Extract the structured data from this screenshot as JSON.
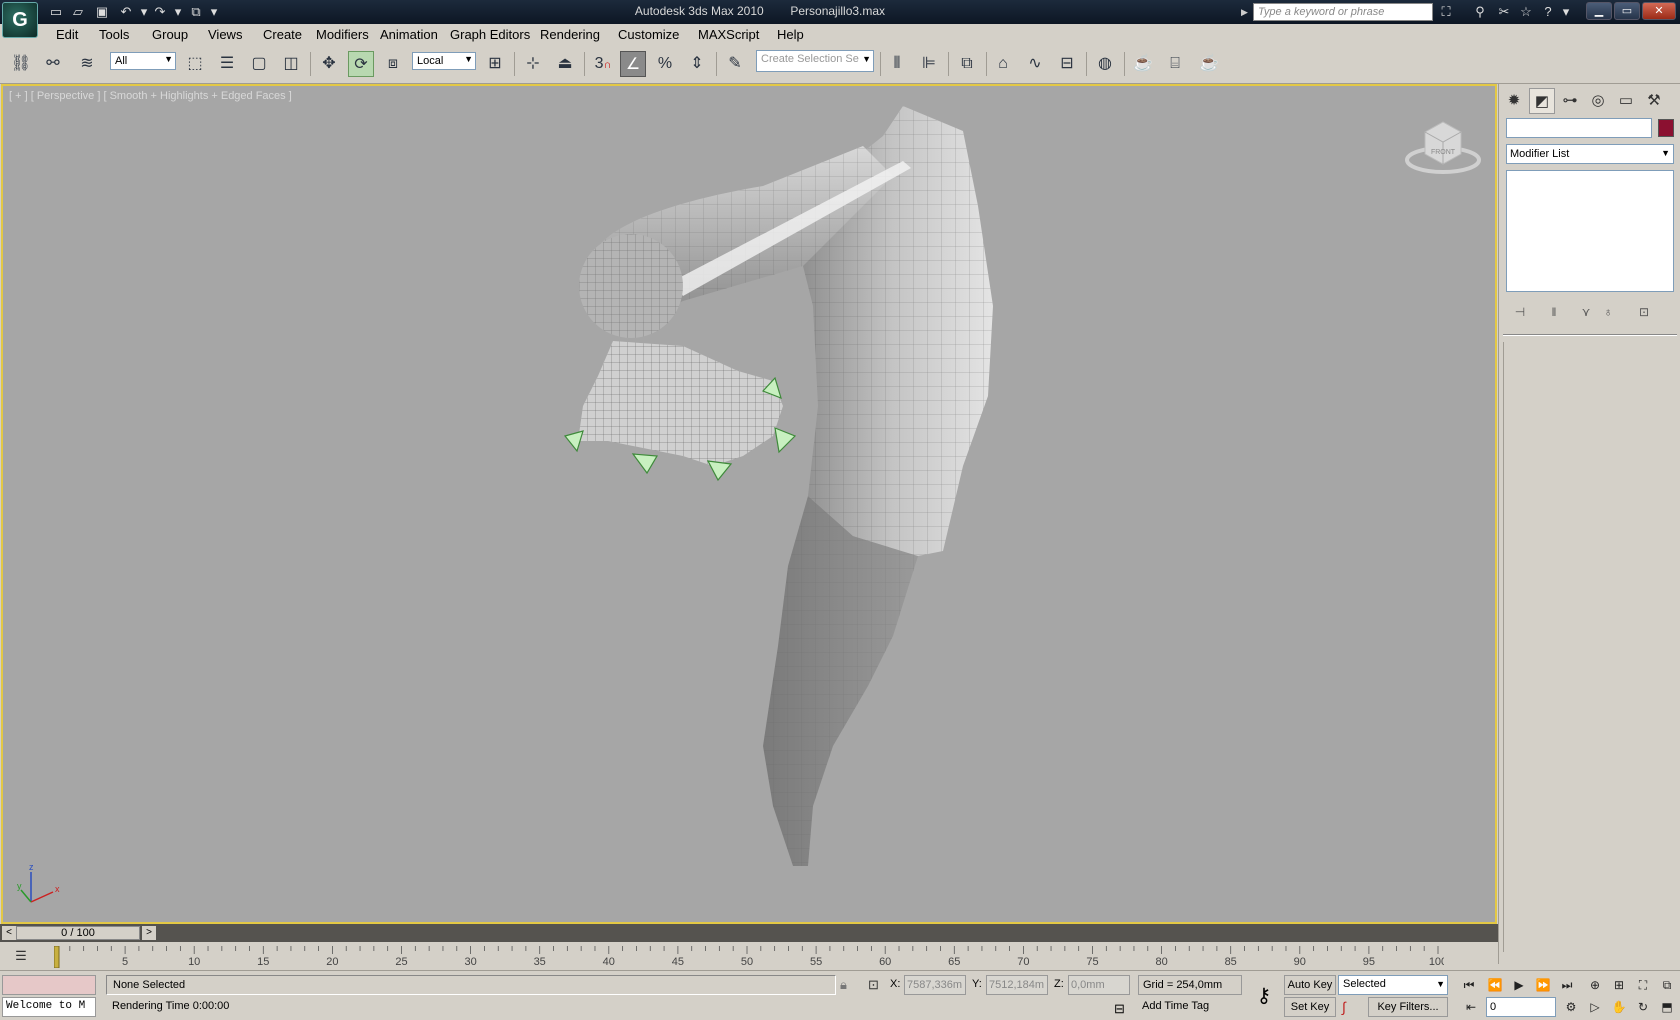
{
  "titlebar": {
    "app_logo": "G",
    "app_name": "Autodesk 3ds Max  2010",
    "file_name": "Personajillo3.max",
    "search_placeholder": "Type a keyword or phrase"
  },
  "menu": [
    "Edit",
    "Tools",
    "Group",
    "Views",
    "Create",
    "Modifiers",
    "Animation",
    "Graph Editors",
    "Rendering",
    "Customize",
    "MAXScript",
    "Help"
  ],
  "toolbar": {
    "selection_filter": "All",
    "coordinate_system": "Local",
    "snap_label": "3",
    "named_selection_placeholder": "Create Selection Se"
  },
  "viewport": {
    "label": "[ + ] [ Perspective ] [ Smooth + Highlights + Edged Faces ]",
    "viewcube_label": "FRONT",
    "axis": {
      "z": "z",
      "y": "y",
      "x": "x"
    }
  },
  "command_panel": {
    "object_color": "#8b1030",
    "modifier_list": "Modifier List"
  },
  "time_slider": {
    "position": "0 / 100",
    "prev": "<",
    "next": ">",
    "current_frame": 0,
    "total_frames": 100
  },
  "track_bar": {
    "ticks": [
      "5",
      "10",
      "15",
      "20",
      "25",
      "30",
      "35",
      "40",
      "45",
      "50",
      "55",
      "60",
      "65",
      "70",
      "75",
      "80",
      "85",
      "90",
      "95",
      "100"
    ]
  },
  "status": {
    "maxscript_text": "Welcome to M",
    "selection": "None Selected",
    "prompt": "Rendering Time  0:00:00",
    "x_label": "X:",
    "x_value": "7587,336m",
    "y_label": "Y:",
    "y_value": "7512,184m",
    "z_label": "Z:",
    "z_value": "0,0mm",
    "grid": "Grid = 254,0mm",
    "time_tag": "Add Time Tag",
    "auto_key": "Auto Key",
    "set_key": "Set Key",
    "key_mode": "Selected",
    "key_filters": "Key Filters...",
    "frame": "0"
  }
}
